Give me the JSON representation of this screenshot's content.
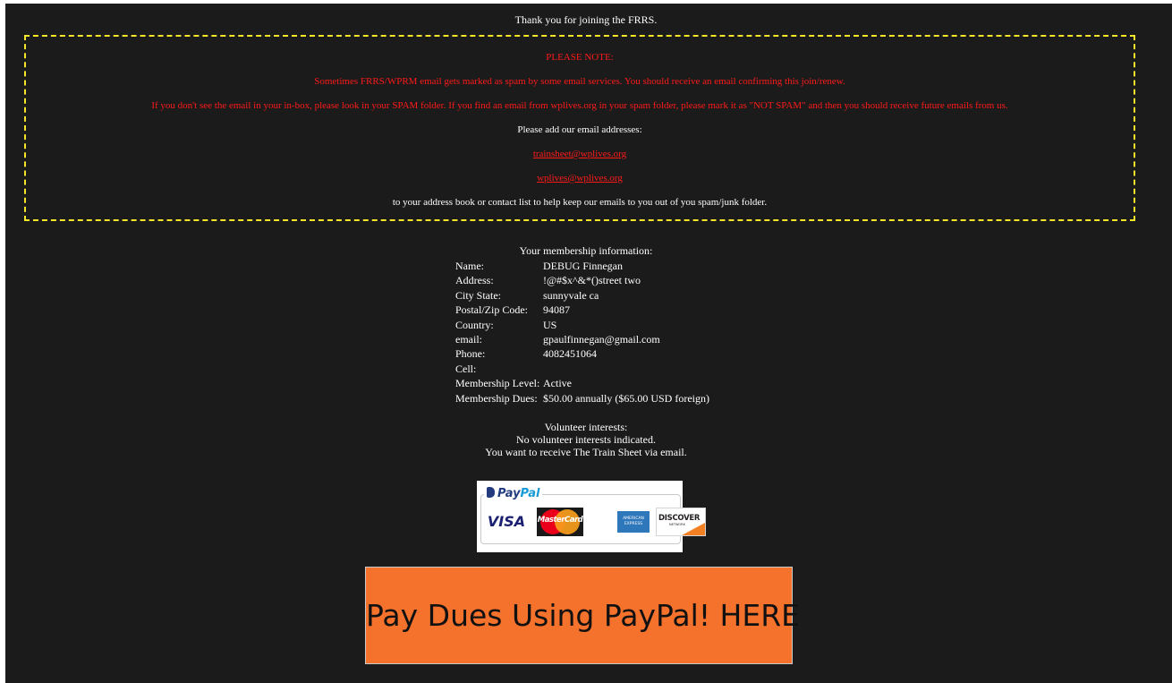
{
  "thank_you": "Thank you for joining the FRRS.",
  "note": {
    "heading": "PLEASE NOTE:",
    "spam_warning": "Sometimes FRRS/WPRM email gets marked as spam by some email services. You should receive an email confirming this join/renew.",
    "spam_instructions": "If you don't see the email in your in-box, please look in your SPAM folder. If you find an email from wplives.org in your spam folder, please mark it as \"NOT SPAM\" and then you should receive future emails from us.",
    "add_addresses": "Please add our email addresses:",
    "email_1": "trainsheet@wplives.org",
    "email_2": "wplives@wplives.org",
    "closing": "to your address book or contact list to help keep our emails to you out of you spam/junk folder.",
    "border_color": "#f5e62a",
    "text_color": "#ff1a1a"
  },
  "membership": {
    "header": "Your membership information:",
    "rows": [
      {
        "label": "Name:",
        "value": "DEBUG Finnegan"
      },
      {
        "label": "Address:",
        "value": "!@#$x^&*()street two"
      },
      {
        "label": "City State:",
        "value": "sunnyvale ca"
      },
      {
        "label": "Postal/Zip Code:",
        "value": "94087"
      },
      {
        "label": "Country:",
        "value": "US"
      },
      {
        "label": "email:",
        "value": "gpaulfinnegan@gmail.com"
      },
      {
        "label": "Phone:",
        "value": "4082451064"
      },
      {
        "label": "Cell:",
        "value": ""
      },
      {
        "label": "Membership Level:",
        "value": "Active"
      },
      {
        "label": "Membership Dues:",
        "value": "$50.00 annually ($65.00 USD foreign)"
      }
    ]
  },
  "volunteer": {
    "header": "Volunteer interests:",
    "status": "No volunteer interests indicated.",
    "train_sheet": "You want to receive The Train Sheet via email."
  },
  "paypal_badge": {
    "brand_part1": "Pay",
    "brand_part2": "Pal",
    "cards": [
      "VISA",
      "MasterCard",
      "AMERICAN EXPRESS",
      "DISCOVER"
    ],
    "discover_sub": "NETWORK",
    "icons": [
      "paypal-logo-icon",
      "visa-card-icon",
      "mastercard-card-icon",
      "amex-card-icon",
      "discover-card-icon"
    ]
  },
  "pay_button": {
    "label": "Pay Dues Using PayPal! HERE",
    "color": "#f5722c"
  },
  "colors": {
    "background": "#1b1b1b",
    "text": "#ffffff"
  }
}
